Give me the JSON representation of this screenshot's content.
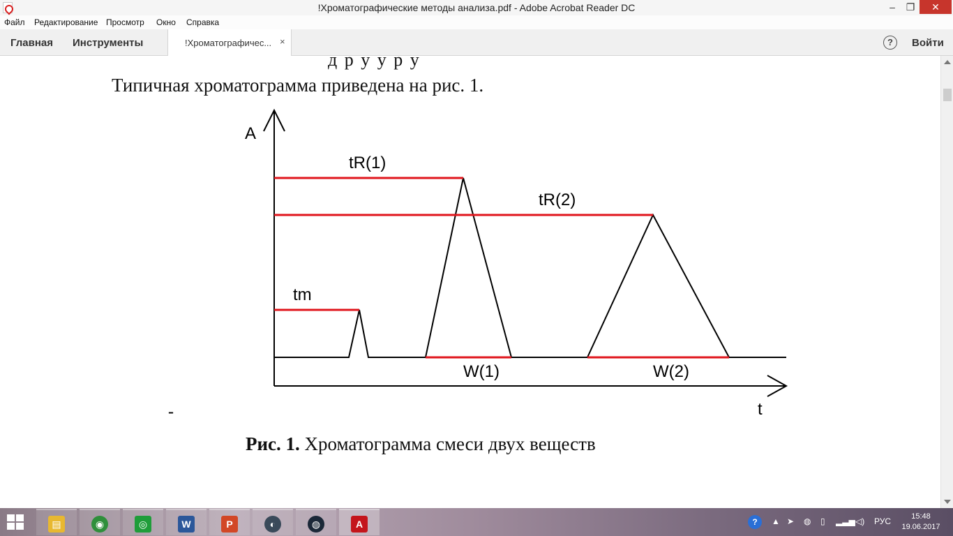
{
  "window": {
    "title": "!Хроматографические методы анализа.pdf - Adobe Acrobat Reader DC",
    "minimize": "–",
    "maximize": "❐",
    "close": "✕"
  },
  "menu": [
    "Файл",
    "Редактирование",
    "Просмотр",
    "Окно",
    "Справка"
  ],
  "toolbar": {
    "home": "Главная",
    "tools": "Инструменты",
    "doc_tab": "!Хроматографичес...",
    "doc_tab_close": "×",
    "help": "?",
    "signin": "Войти"
  },
  "document": {
    "cut_line": "д                р                        у     у     р     у",
    "paragraph": "Типичная хроматограмма приведена на рис. 1.",
    "dash": "-",
    "caption_bold": "Рис. 1.",
    "caption_rest": " Хроматограмма смеси двух веществ"
  },
  "figure": {
    "y_axis_label": "A",
    "x_axis_label": "t",
    "labels": {
      "tm": "tm",
      "tr1": "tR(1)",
      "tr2": "tR(2)",
      "w1": "W(1)",
      "w2": "W(2)"
    },
    "colors": {
      "axis": "#000000",
      "marker": "#e0141b"
    }
  },
  "taskbar": {
    "apps": [
      {
        "name": "file-explorer",
        "glyph": "▤",
        "color": "#e8b830"
      },
      {
        "name": "chrome",
        "glyph": "◉",
        "color": "#2f8f3b"
      },
      {
        "name": "camera-app",
        "glyph": "◎",
        "color": "#1f9d3a"
      },
      {
        "name": "word",
        "glyph": "W",
        "color": "#2b579a"
      },
      {
        "name": "powerpoint",
        "glyph": "P",
        "color": "#d24726"
      },
      {
        "name": "media-app",
        "glyph": "◐",
        "color": "#3a4a5a"
      },
      {
        "name": "steam",
        "glyph": "◍",
        "color": "#1b2838"
      },
      {
        "name": "acrobat",
        "glyph": "A",
        "color": "#c4151c"
      }
    ],
    "language": "РУС",
    "time": "15:48",
    "date": "19.06.2017"
  }
}
